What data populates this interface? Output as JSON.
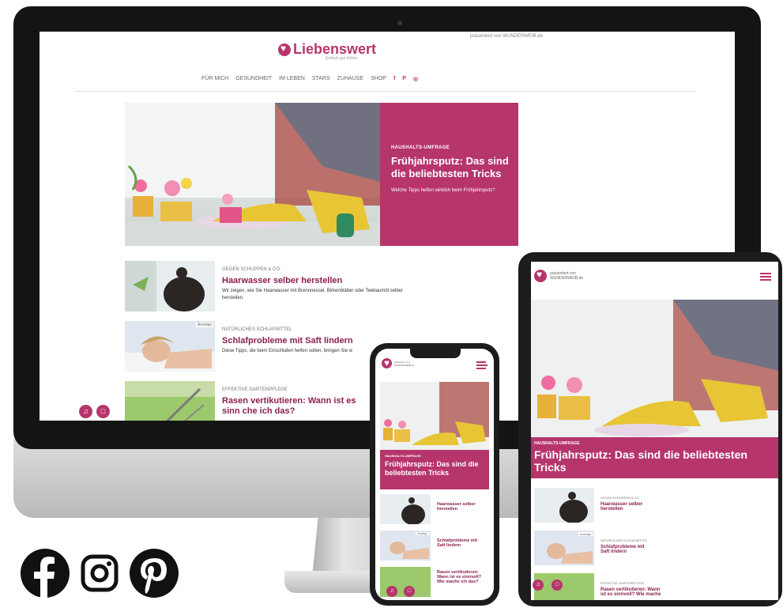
{
  "site": {
    "name": "Liebenswert",
    "tagline": "Einfach gut fühlen.",
    "sponsor": "präsentiert von WUNDERWEIB.de",
    "nav": [
      "FÜR MICH",
      "GESUNDHEIT",
      "IM LEBEN",
      "STARS",
      "ZUHAUSE",
      "SHOP"
    ],
    "social_nav": [
      "f",
      "P",
      "◎"
    ]
  },
  "hero": {
    "kicker": "HAUSHALTS-UMFRAGE",
    "title": "Frühjahrsputz: Das sind die beliebtesten Tricks",
    "subtitle": "Welche Tipps helfen wirklich beim Frühjahrsputz?"
  },
  "articles": [
    {
      "kicker": "GEGEN SCHUPPEN & CO.",
      "title": "Haarwasser selber herstellen",
      "summary": "Wir zeigen, wie Sie Haarwasser mit Brennnessel, Birkenblätter oder Teebaumöl selber herstellen.",
      "badge": ""
    },
    {
      "kicker": "NATÜRLICHES SCHLAFMITTEL",
      "title": "Schlafprobleme mit Saft lindern",
      "summary": "Diese Tipps, die beim Einschlafen helfen sollen, bringen Sie w",
      "badge": "Anzeige"
    },
    {
      "kicker": "EFFEKTIVE GARTENPFLEGE",
      "title": "Rasen vertikutieren: Wann ist es sinn che ich das?",
      "summary": "",
      "badge": ""
    }
  ],
  "mobile": {
    "sponsor": "präsentiert von WUNDERWEIB.de",
    "hero_kicker": "HAUSHALTS-UMFRAGE",
    "hero_title": "Frühjahrsputz: Das sind die beliebtesten Tricks",
    "items": [
      {
        "title": "Haarwasser selber herstellen"
      },
      {
        "title": "Schlafprobleme mit Saft lindern",
        "badge": "Anzeige"
      },
      {
        "title": "Rasen vertikutieren: Wann ist es sinnvoll? Wie mache ich das?"
      }
    ]
  },
  "tablet": {
    "sponsor": "präsentiert von WUNDERWEIB.de",
    "hero_kicker": "HAUSHALTS-UMFRAGE",
    "hero_title": "Frühjahrsputz: Das sind die beliebtesten Tricks",
    "items": [
      {
        "kicker": "GEGEN SCHUPPEN & CO.",
        "title": "Haarwasser selber herstellen"
      },
      {
        "kicker": "NATÜRLICHES SCHLAFMITTEL",
        "title": "Schlafprobleme mit Saft lindern",
        "badge": "Anzeige"
      },
      {
        "kicker": "EFFEKTIVE GARTENPFLEGE",
        "title": "Rasen vertikutieren: Wann ist es sinnvoll? Wie mache"
      }
    ]
  },
  "colors": {
    "brand": "#b6356b",
    "title": "#8c1f4f"
  },
  "icons": [
    "facebook-icon",
    "instagram-icon",
    "pinterest-icon",
    "bell-icon",
    "bag-icon",
    "menu-icon"
  ]
}
